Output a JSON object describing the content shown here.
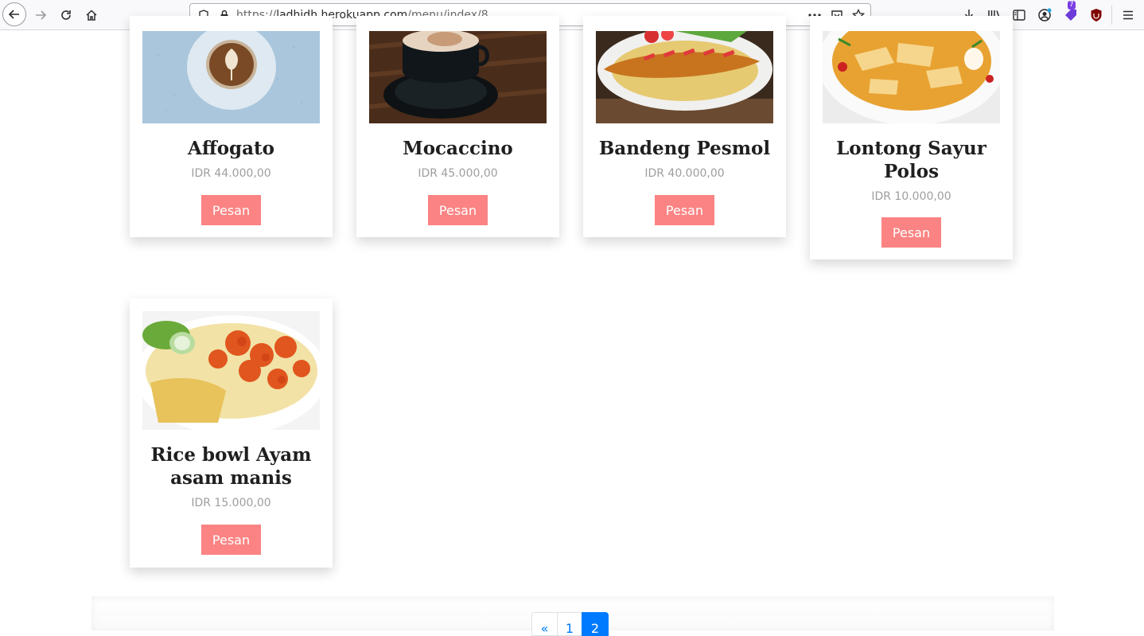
{
  "browser": {
    "url_prefix": "https://",
    "url_host": "ladhidh.herokuapp.com",
    "url_path": "/menu/index/8",
    "extension_badge": "7"
  },
  "colors": {
    "order_button": "#fb8383",
    "pagination_active": "#007bff"
  },
  "menu": {
    "items": [
      {
        "name": "Affogato",
        "price": "IDR 44.000,00",
        "order_label": "Pesan",
        "image": "latte-art-coffee-photo"
      },
      {
        "name": "Mocaccino",
        "price": "IDR 45.000,00",
        "order_label": "Pesan",
        "image": "mocha-cup-photo"
      },
      {
        "name": "Bandeng Pesmol",
        "price": "IDR 40.000,00",
        "order_label": "Pesan",
        "image": "fried-milkfish-photo"
      },
      {
        "name": "Lontong Sayur Polos",
        "price": "IDR 10.000,00",
        "order_label": "Pesan",
        "image": "lontong-curry-photo"
      },
      {
        "name": "Rice bowl Ayam asam manis",
        "price": "IDR 15.000,00",
        "order_label": "Pesan",
        "image": "sweet-sour-chicken-bowl-photo"
      }
    ]
  },
  "pagination": {
    "prev": "«",
    "pages": [
      "1",
      "2"
    ],
    "active": "2"
  }
}
